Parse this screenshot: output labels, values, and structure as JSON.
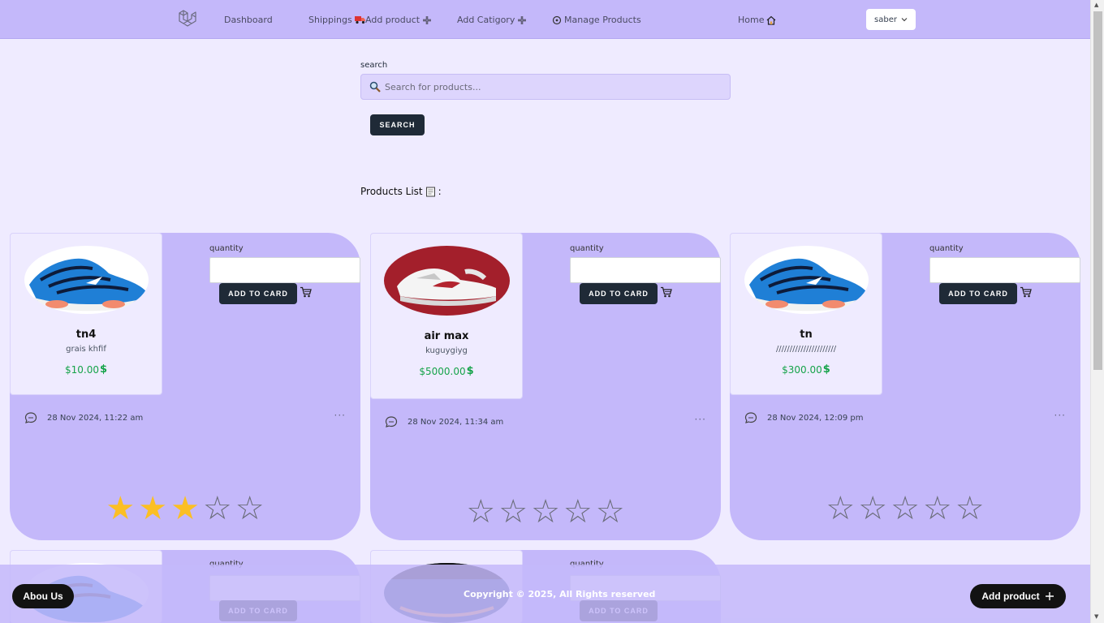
{
  "nav": {
    "items": [
      {
        "label": "Dashboard",
        "icon": ""
      },
      {
        "label": "Shippings",
        "icon": "truck-icon"
      },
      {
        "label": "Add product",
        "icon": "plus-icon"
      },
      {
        "label": "Add Catigory",
        "icon": "plus-icon"
      },
      {
        "label": "Manage Products",
        "icon": "gear-icon"
      },
      {
        "label": "Home",
        "icon": "home-icon"
      }
    ],
    "user": "saber"
  },
  "search": {
    "label": "search",
    "placeholder": "Search for products...",
    "button": "SEARCH"
  },
  "products_list_title": "Products List",
  "products_list_suffix": ":",
  "quantity_label": "quantity",
  "add_to_cart_label": "ADD TO CARD",
  "products": [
    {
      "name": "tn4",
      "desc": "grais khfif",
      "price": "$10.00",
      "date": "28 Nov 2024, 11:22 am",
      "rating": 3,
      "image": "blue-sneaker"
    },
    {
      "name": "air max",
      "desc": "kuguygiyg",
      "price": "$5000.00",
      "date": "28 Nov 2024, 11:34 am",
      "rating": 0,
      "image": "red-sneaker"
    },
    {
      "name": "tn",
      "desc": "//////////////////////",
      "price": "$300.00",
      "date": "28 Nov 2024, 12:09 pm",
      "rating": 0,
      "image": "blue-sneaker"
    }
  ],
  "footer": {
    "about": "Abou Us",
    "copyright": "Copyright © 2025, All Rights reserved",
    "add_product": "Add product"
  },
  "colors": {
    "accent": "#c4b8fa",
    "background": "#efebff",
    "button": "#1f2a37",
    "price": "#16a34a",
    "star": "#fbbf24"
  }
}
